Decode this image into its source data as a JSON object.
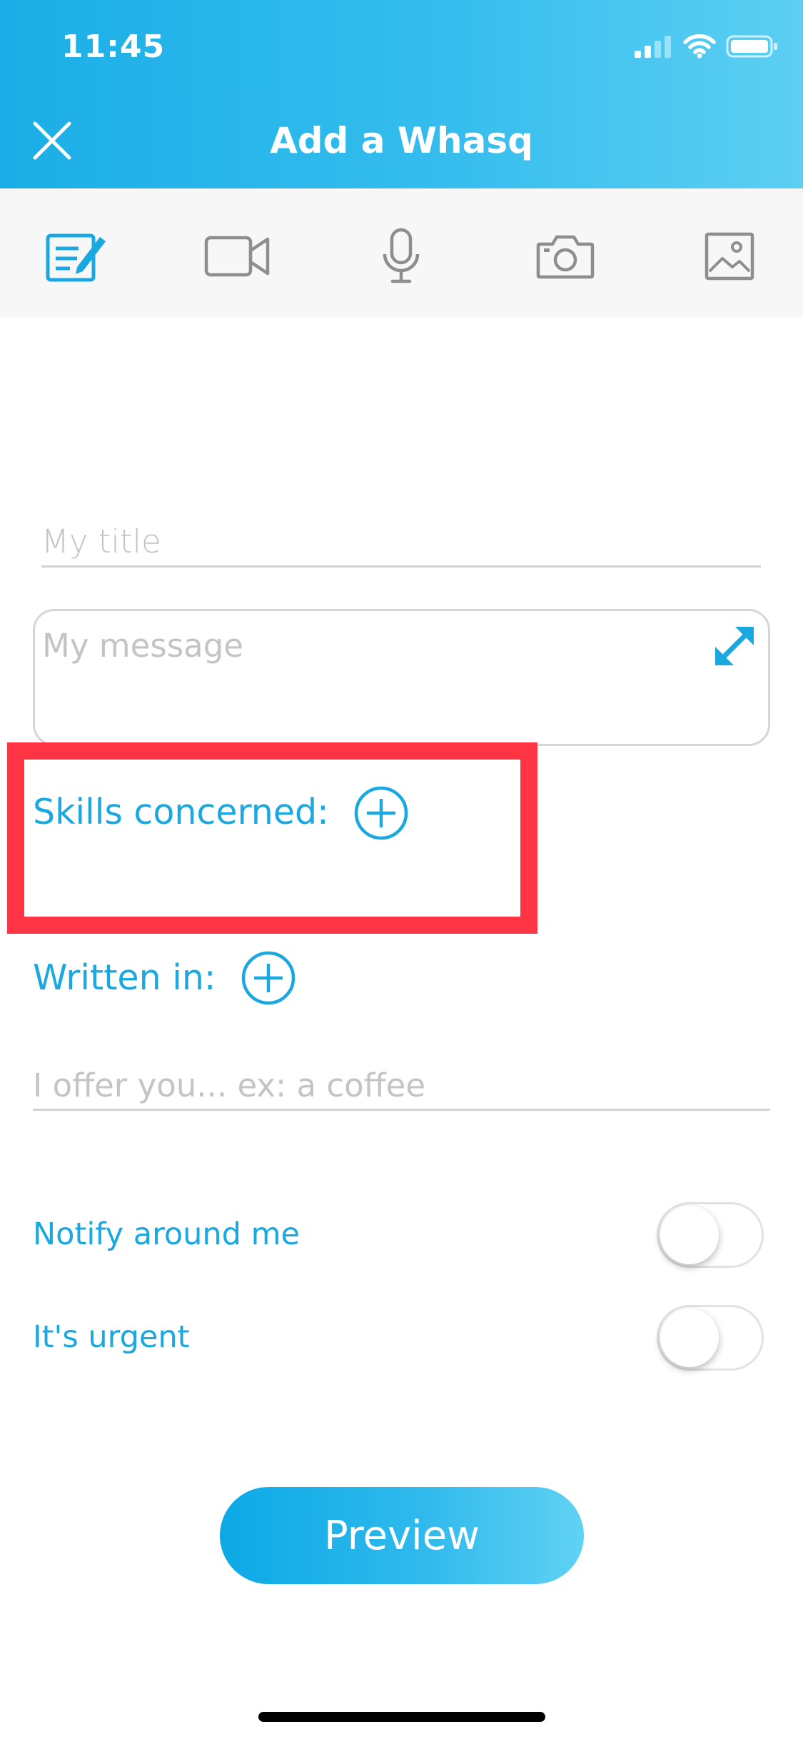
{
  "status_bar": {
    "time": "11:45"
  },
  "header": {
    "title": "Add a Whasq"
  },
  "toolbar": {
    "tools": [
      {
        "icon": "edit-note-icon",
        "active": true
      },
      {
        "icon": "video-camera-icon",
        "active": false
      },
      {
        "icon": "microphone-icon",
        "active": false
      },
      {
        "icon": "camera-icon",
        "active": false
      },
      {
        "icon": "image-icon",
        "active": false
      }
    ]
  },
  "form": {
    "title_placeholder": "My title",
    "message_placeholder": "My message",
    "skills_label": "Skills concerned:",
    "written_in_label": "Written in:",
    "offer_placeholder": "I offer you... ex: a coffee",
    "notify_label": "Notify around me",
    "notify_on": false,
    "urgent_label": "It's urgent",
    "urgent_on": false
  },
  "actions": {
    "preview_label": "Preview"
  },
  "colors": {
    "accent": "#1aa8e0",
    "highlight": "#ff3444",
    "header_start": "#1aaee6",
    "header_end": "#5ccff2"
  }
}
